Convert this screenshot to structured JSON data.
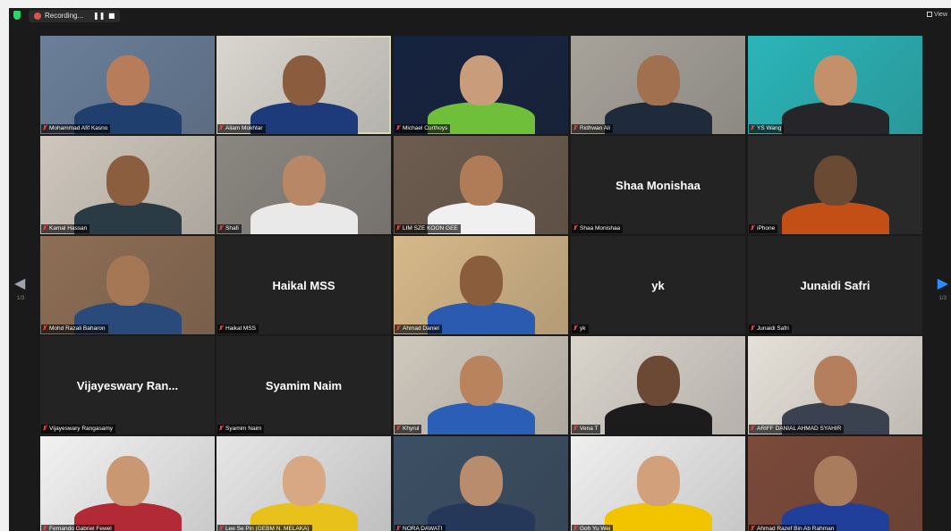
{
  "window": {
    "recording_label": "Recording...",
    "pause_symbol": "❚❚",
    "stop_symbol": "■",
    "view_label": "View",
    "prev_symbol": "◀",
    "next_symbol": "▶",
    "page_left": "1/3",
    "page_right": "1/3"
  },
  "colors": {
    "active_speaker_border": "#c7e24a",
    "muted_mic": "#e04141",
    "recording_dot": "#d9534f",
    "nav_arrow": "#2d8cff"
  },
  "participants": [
    {
      "name": "Mohammad Afif Kasno",
      "video": true
    },
    {
      "name": "Aliam Mokhtar",
      "video": true,
      "active": true
    },
    {
      "name": "Michael Curthoys",
      "video": true
    },
    {
      "name": "Ridhwan Ali",
      "video": true
    },
    {
      "name": "YS Wang",
      "video": true
    },
    {
      "name": "Kamal Hassan",
      "video": true
    },
    {
      "name": "Shafi",
      "video": true
    },
    {
      "name": "LIM SZE KOON GEE",
      "video": true
    },
    {
      "name": "Shaa Monishaa",
      "video": false,
      "display_name": "Shaa Monishaa"
    },
    {
      "name": "iPhone",
      "video": true
    },
    {
      "name": "Mohd Razali Baharon",
      "video": true
    },
    {
      "name": "Haikal MSS",
      "video": false,
      "display_name": "Haikal MSS"
    },
    {
      "name": "Ahmad Daniel",
      "video": true
    },
    {
      "name": "yk",
      "video": false,
      "display_name": "yk"
    },
    {
      "name": "Junaidi Safri",
      "video": false,
      "display_name": "Junaidi Safri"
    },
    {
      "name": "Vijayeswary Rangasamy",
      "video": false,
      "display_name": "Vijayeswary  Ran..."
    },
    {
      "name": "Syamim Naim",
      "video": false,
      "display_name": "Syamim Naim"
    },
    {
      "name": "Khyrul",
      "video": true
    },
    {
      "name": "Vena T",
      "video": true
    },
    {
      "name": "ARIFF DANIAL AHMAD SYAHIR",
      "video": true
    },
    {
      "name": "Fernando Gabriel Fewel",
      "video": true
    },
    {
      "name": "Lee Se Pin (GEBM N. MELAKA)",
      "video": true
    },
    {
      "name": "NORA DAWATI",
      "video": true
    },
    {
      "name": "Goh Yu Wei",
      "video": true
    },
    {
      "name": "Ahmad Razef Bin Ab Rahman",
      "video": true
    }
  ]
}
